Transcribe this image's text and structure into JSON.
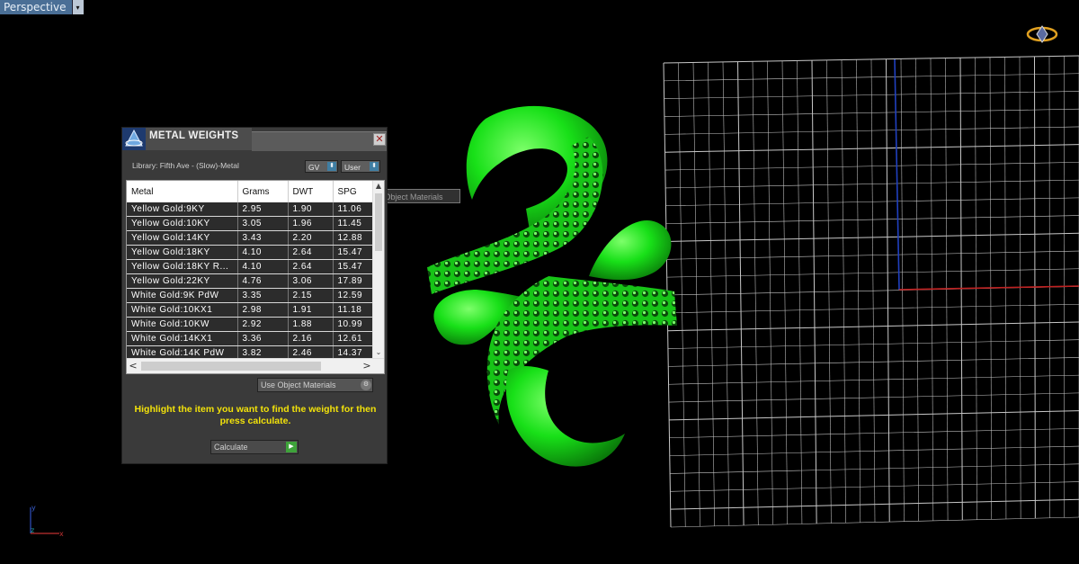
{
  "viewport": {
    "name": "Perspective",
    "dropdown_glyph": "▾"
  },
  "dialog": {
    "title": "METAL WEIGHTS",
    "close_glyph": "✕",
    "library_label": "Library: Fifth Ave - (Slow)-Metal",
    "gv_label": "GV",
    "user_label": "User",
    "columns": [
      "Metal",
      "Grams",
      "DWT",
      "SPG"
    ],
    "rows": [
      [
        "Yellow Gold:9KY",
        "2.95",
        "1.90",
        "11.06"
      ],
      [
        "Yellow Gold:10KY",
        "3.05",
        "1.96",
        "11.45"
      ],
      [
        "Yellow Gold:14KY",
        "3.43",
        "2.20",
        "12.88"
      ],
      [
        "Yellow Gold:18KY",
        "4.10",
        "2.64",
        "15.47"
      ],
      [
        "Yellow Gold:18KY R...",
        "4.10",
        "2.64",
        "15.47"
      ],
      [
        "Yellow Gold:22KY",
        "4.76",
        "3.06",
        "17.89"
      ],
      [
        "White Gold:9K PdW",
        "3.35",
        "2.15",
        "12.59"
      ],
      [
        "White Gold:10KX1",
        "2.98",
        "1.91",
        "11.18"
      ],
      [
        "White Gold:10KW",
        "2.92",
        "1.88",
        "10.99"
      ],
      [
        "White Gold:14KX1",
        "3.36",
        "2.16",
        "12.61"
      ],
      [
        "White Gold:14K PdW",
        "3.82",
        "2.46",
        "14.37"
      ]
    ],
    "tooltip": "Use Object Materials",
    "use_object_materials": "Use Object Materials",
    "hint": "Highlight the item you want to find the weight for then press calculate.",
    "calculate_label": "Calculate",
    "scroll_up": "▲",
    "scroll_down": "⌄",
    "scroll_left": "<",
    "scroll_right": ">"
  },
  "axes": {
    "y": "y",
    "z": "z",
    "x": "x"
  },
  "colors": {
    "model": "#18e018",
    "grid": "#c8c8c8",
    "y_axis": "#2040c0",
    "x_axis": "#c02020"
  }
}
